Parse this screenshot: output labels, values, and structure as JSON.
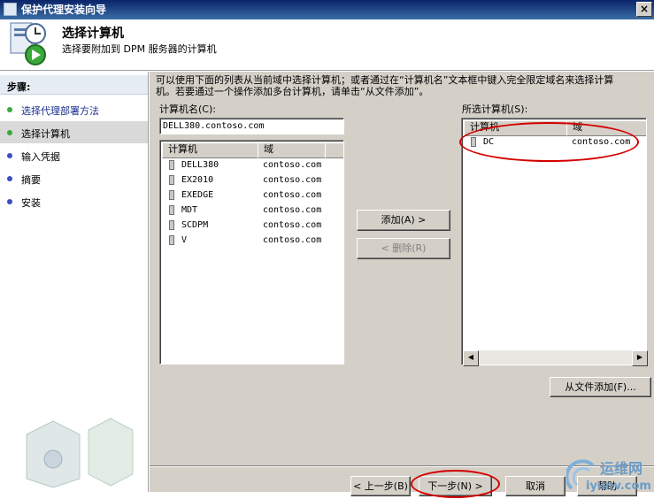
{
  "window": {
    "title": "保护代理安装向导",
    "close_label": "×"
  },
  "header": {
    "title": "选择计算机",
    "subtitle": "选择要附加到 DPM 服务器的计算机"
  },
  "sidebar": {
    "heading": "步骤:",
    "steps": [
      {
        "label": "选择代理部署方法",
        "color": "#3aa83a"
      },
      {
        "label": "选择计算机",
        "color": "#3aa83a"
      },
      {
        "label": "输入凭据",
        "color": "#3d4dbf"
      },
      {
        "label": "摘要",
        "color": "#3d4dbf"
      },
      {
        "label": "安装",
        "color": "#3d4dbf"
      }
    ]
  },
  "main": {
    "instructions": "可以使用下面的列表从当前域中选择计算机；或者通过在“计算机名”文本框中键入完全限定域名来选择计算机。若要通过一个操作添加多台计算机，请单击“从文件添加”。",
    "computer_name_label": "计算机名(C):",
    "computer_name_value": "DELL380.contoso.com",
    "available": {
      "columns": [
        "计算机",
        "域"
      ],
      "rows": [
        {
          "name": "DELL380",
          "domain": "contoso.com"
        },
        {
          "name": "EX2010",
          "domain": "contoso.com"
        },
        {
          "name": "EXEDGE",
          "domain": "contoso.com"
        },
        {
          "name": "MDT",
          "domain": "contoso.com"
        },
        {
          "name": "SCDPM",
          "domain": "contoso.com"
        },
        {
          "name": "V",
          "domain": "contoso.com"
        }
      ]
    },
    "add_button": "添加(A) >",
    "remove_button": "< 删除(R)",
    "selected_label": "所选计算机(S):",
    "selected": {
      "columns": [
        "计算机",
        "域"
      ],
      "rows": [
        {
          "name": "DC",
          "domain": "contoso.com"
        }
      ]
    },
    "add_from_file_button": "从文件添加(F)..."
  },
  "footer": {
    "back_button": "< 上一步(B)",
    "next_button": "下一步(N) >",
    "cancel_button": "取消",
    "help_button": "帮助"
  },
  "watermark": {
    "text": "运维网",
    "url_text": "iyunv.com"
  },
  "colors": {
    "annotation_red": "#d40000",
    "titlebar": "#0a246a"
  }
}
